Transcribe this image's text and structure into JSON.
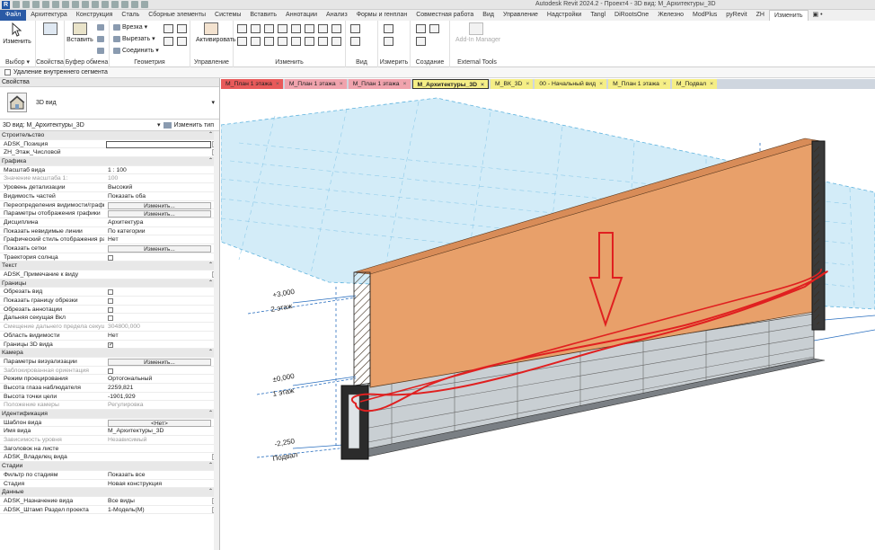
{
  "titlebar": {
    "logo": "R",
    "title": "Autodesk Revit 2024.2 - Проект4 - 3D вид: М_Архитектуры_3D"
  },
  "ribbon_tabs": [
    "Файл",
    "Архитектура",
    "Конструкция",
    "Сталь",
    "Сборные элементы",
    "Системы",
    "Вставить",
    "Аннотации",
    "Анализ",
    "Формы и генплан",
    "Совместная работа",
    "Вид",
    "Управление",
    "Надстройки",
    "Tangl",
    "DiRootsOne",
    "Железно",
    "ModPlus",
    "pyRevit",
    "ZH",
    "Изменить",
    "▣ •"
  ],
  "active_tab_index": 20,
  "ribbon": {
    "modify_label": "Изменить",
    "select_label": "Выбор ▾",
    "properties_label": "Свойства",
    "paste_label": "Вставить",
    "clipboard_label": "Буфер обмена",
    "cope_label": "Врезка ▾",
    "cut_label": "Вырезать ▾",
    "join_label": "Соединить ▾",
    "geometry_label": "Геометрия",
    "activate_label": "Активировать",
    "control_label": "Управление",
    "modify_group_label": "Изменить",
    "view_label": "Вид",
    "measure_label": "Измерить",
    "create_label": "Создание",
    "add_in_manager": "Add-In Manager",
    "external_tools": "External Tools"
  },
  "options_bar": {
    "checkbox_label": "Удаление внутреннего сегмента"
  },
  "properties": {
    "header": "Свойства",
    "type_name": "3D вид",
    "instance": "3D вид: М_Архитектуры_3D",
    "edit_type": "Изменить тип",
    "rows": [
      {
        "kind": "sec",
        "name": "Строительство"
      },
      {
        "name": "ADSK_Позиция",
        "value": "",
        "ctl": "input"
      },
      {
        "name": "ZH_Этаж_Числовой",
        "value": ""
      },
      {
        "kind": "sec",
        "name": "Графика"
      },
      {
        "name": "Масштаб вида",
        "value": "1 : 100"
      },
      {
        "name": "Значение масштаба    1:",
        "value": "100",
        "grey": true
      },
      {
        "name": "Уровень детализации",
        "value": "Высокий"
      },
      {
        "name": "Видимость частей",
        "value": "Показать оба"
      },
      {
        "name": "Переопределения видимости/графи...",
        "value": "Изменить...",
        "ctl": "btn"
      },
      {
        "name": "Параметры отображения графики",
        "value": "Изменить...",
        "ctl": "btn"
      },
      {
        "name": "Дисциплина",
        "value": "Архитектура"
      },
      {
        "name": "Показать невидимые линии",
        "value": "По категории"
      },
      {
        "name": "Графический стиль отображения ра...",
        "value": "Нет"
      },
      {
        "name": "Показать сетки",
        "value": "Изменить...",
        "ctl": "btn"
      },
      {
        "name": "Траектория солнца",
        "value": "",
        "ctl": "chk"
      },
      {
        "kind": "sec",
        "name": "Текст"
      },
      {
        "name": "ADSK_Примечание к виду",
        "value": ""
      },
      {
        "kind": "sec",
        "name": "Границы"
      },
      {
        "name": "Обрезать вид",
        "value": "",
        "ctl": "chk"
      },
      {
        "name": "Показать границу обрезки",
        "value": "",
        "ctl": "chk"
      },
      {
        "name": "Обрезать аннотации",
        "value": "",
        "ctl": "chk"
      },
      {
        "name": "Дальняя секущая Вкл",
        "value": "",
        "ctl": "chk"
      },
      {
        "name": "Смещение дальнего предела секущ...",
        "value": "304800,000",
        "grey": true
      },
      {
        "name": "Область видимости",
        "value": "Нет"
      },
      {
        "name": "Границы 3D вида",
        "value": "",
        "ctl": "chkon"
      },
      {
        "kind": "sec",
        "name": "Камера"
      },
      {
        "name": "Параметры визуализации",
        "value": "Изменить...",
        "ctl": "btn"
      },
      {
        "name": "Заблокированная ориентация",
        "value": "",
        "ctl": "chk",
        "grey": true
      },
      {
        "name": "Режим проецирования",
        "value": "Ортогональный"
      },
      {
        "name": "Высота глаза наблюдателя",
        "value": "2259,821"
      },
      {
        "name": "Высота точки цели",
        "value": "-1901,929"
      },
      {
        "name": "Положение камеры",
        "value": "Регулировка",
        "grey": true
      },
      {
        "kind": "sec",
        "name": "Идентификация"
      },
      {
        "name": "Шаблон вида",
        "value": "<Нет>",
        "ctl": "btn"
      },
      {
        "name": "Имя вида",
        "value": "М_Архитектуры_3D"
      },
      {
        "name": "Зависимость уровня",
        "value": "Независимый",
        "grey": true
      },
      {
        "name": "Заголовок на листе",
        "value": ""
      },
      {
        "name": "ADSK_Владелец вида",
        "value": ""
      },
      {
        "kind": "sec",
        "name": "Стадии"
      },
      {
        "name": "Фильтр по стадиям",
        "value": "Показать все"
      },
      {
        "name": "Стадия",
        "value": "Новая конструкция"
      },
      {
        "kind": "sec",
        "name": "Данные"
      },
      {
        "name": "ADSK_Назначение вида",
        "value": "Все виды"
      },
      {
        "name": "ADSK_Штамп Раздел проекта",
        "value": "1-Модель(М)"
      }
    ]
  },
  "doc_tabs": [
    {
      "label": "М_План 1 этажа",
      "color": "#e85a5a"
    },
    {
      "label": "М_План 1 этажа",
      "color": "#f0a3ad"
    },
    {
      "label": "М_План 1 этажа",
      "color": "#f0a3ad"
    },
    {
      "label": "М_Архитектуры_3D",
      "color": "#f5ee86",
      "active": true
    },
    {
      "label": "М_ВК_3D",
      "color": "#f5ee86"
    },
    {
      "label": "00 - Начальный вид",
      "color": "#f5ee86"
    },
    {
      "label": "М_План 1 этажа",
      "color": "#f5ee86"
    },
    {
      "label": "М_Подвал",
      "color": "#f5ee86"
    }
  ],
  "levels": [
    {
      "elevation": "+3,000",
      "name": "2 этаж"
    },
    {
      "elevation": "±0,000",
      "name": "1 этаж"
    },
    {
      "elevation": "-2,250",
      "name": "Подвал"
    }
  ],
  "colors": {
    "wall": "#e8a06a",
    "annotation": "#e02020",
    "plane": "#cfe9f6",
    "plane_line": "#5fb3de"
  }
}
